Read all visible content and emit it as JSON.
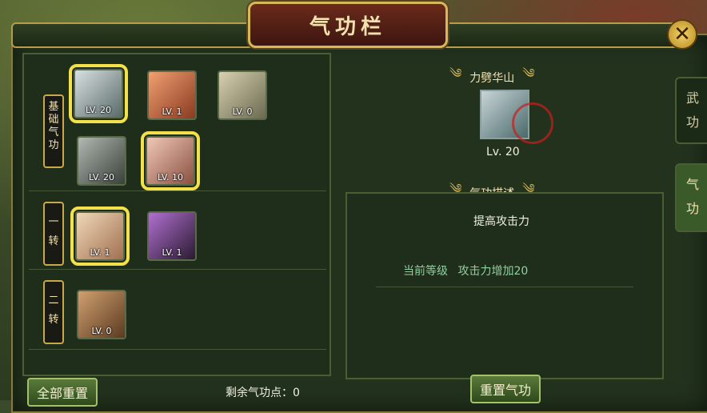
{
  "window": {
    "title": "气功栏",
    "close_label": "✕"
  },
  "side_tabs": [
    {
      "label": "武功",
      "active": false
    },
    {
      "label": "气功",
      "active": true
    }
  ],
  "tiers": [
    {
      "label": "基础气功",
      "skills": [
        {
          "level": "LV. 20",
          "highlight": true,
          "icon": "fist-chain-icon",
          "colors": [
            "#d8e0e0",
            "#5a6a6a"
          ]
        },
        {
          "level": "LV. 1",
          "highlight": false,
          "icon": "burst-icon",
          "colors": [
            "#f0a070",
            "#8a3a20"
          ]
        },
        {
          "level": "LV. 0",
          "highlight": false,
          "icon": "wind-icon",
          "colors": [
            "#d8d0b0",
            "#6a6a50"
          ]
        },
        {
          "level": "LV. 20",
          "highlight": false,
          "icon": "armor-icon",
          "colors": [
            "#b0b8b0",
            "#3a403a"
          ]
        },
        {
          "level": "LV. 10",
          "highlight": true,
          "icon": "warrior-portrait-icon",
          "colors": [
            "#f0c8b8",
            "#8a5040"
          ]
        }
      ]
    },
    {
      "label": "一转",
      "skills": [
        {
          "level": "LV. 1",
          "highlight": true,
          "icon": "palm-icon",
          "colors": [
            "#f0d8b8",
            "#a07050"
          ]
        },
        {
          "level": "LV. 1",
          "highlight": false,
          "icon": "orb-icon",
          "colors": [
            "#b070d0",
            "#2a1a30"
          ]
        }
      ]
    },
    {
      "label": "二转",
      "skills": [
        {
          "level": "LV. 0",
          "highlight": false,
          "icon": "dagger-icon",
          "colors": [
            "#d0a070",
            "#5a3a20"
          ]
        }
      ]
    }
  ],
  "detail": {
    "skill_name": "力劈华山",
    "level": "Lv. 20",
    "section_title": "气功描述",
    "description": "提高攻击力",
    "current_label": "当前等级",
    "current_effect": "攻击力增加20"
  },
  "buttons": {
    "reset_all": "全部重置",
    "reset_qigong": "重置气功"
  },
  "points": {
    "label": "剩余气功点：0"
  }
}
